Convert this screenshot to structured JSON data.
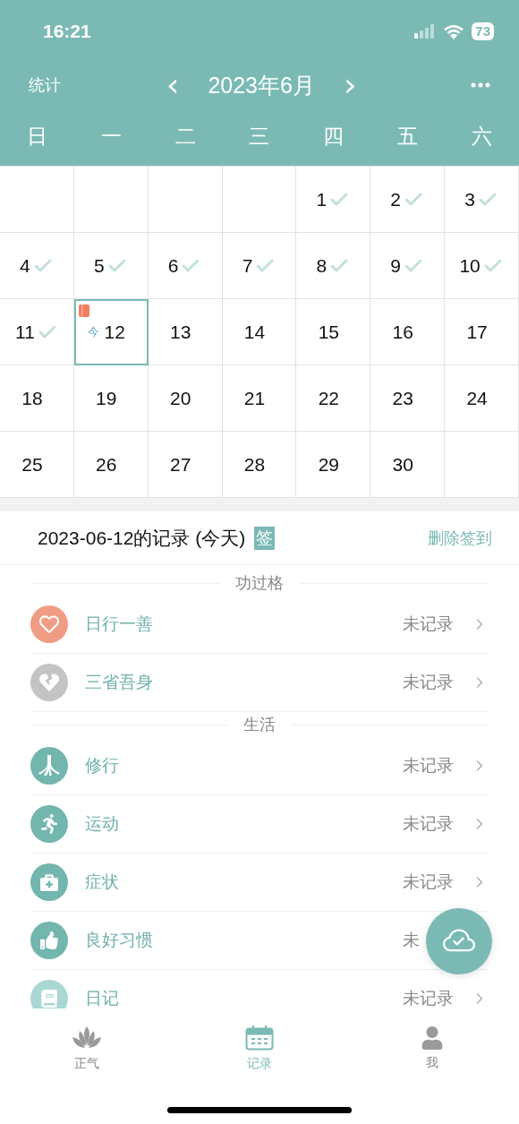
{
  "status_bar": {
    "time": "16:21",
    "battery": "73"
  },
  "nav": {
    "left": "统计",
    "month": "2023年6月",
    "prev": "‹",
    "next": "›"
  },
  "weekdays": [
    "日",
    "一",
    "二",
    "三",
    "四",
    "五",
    "六"
  ],
  "weeks": [
    [
      {
        "kind": "empty"
      },
      {
        "kind": "empty"
      },
      {
        "kind": "empty"
      },
      {
        "kind": "empty"
      },
      {
        "kind": "day",
        "day": "1",
        "checked": true,
        "today": false,
        "note": false
      },
      {
        "kind": "day",
        "day": "2",
        "checked": true,
        "today": false,
        "note": false
      },
      {
        "kind": "day",
        "day": "3",
        "checked": true,
        "today": false,
        "note": false
      }
    ],
    [
      {
        "kind": "day",
        "day": "4",
        "checked": true,
        "today": false,
        "note": false
      },
      {
        "kind": "day",
        "day": "5",
        "checked": true,
        "today": false,
        "note": false
      },
      {
        "kind": "day",
        "day": "6",
        "checked": true,
        "today": false,
        "note": false
      },
      {
        "kind": "day",
        "day": "7",
        "checked": true,
        "today": false,
        "note": false
      },
      {
        "kind": "day",
        "day": "8",
        "checked": true,
        "today": false,
        "note": false
      },
      {
        "kind": "day",
        "day": "9",
        "checked": true,
        "today": false,
        "note": false
      },
      {
        "kind": "day",
        "day": "10",
        "checked": true,
        "today": false,
        "note": false
      }
    ],
    [
      {
        "kind": "day",
        "day": "11",
        "checked": true,
        "today": false,
        "note": false
      },
      {
        "kind": "day",
        "day": "12",
        "checked": false,
        "today": true,
        "note": true,
        "today_label": "今"
      },
      {
        "kind": "day",
        "day": "13",
        "checked": false,
        "today": false,
        "note": false
      },
      {
        "kind": "day",
        "day": "14",
        "checked": false,
        "today": false,
        "note": false
      },
      {
        "kind": "day",
        "day": "15",
        "checked": false,
        "today": false,
        "note": false
      },
      {
        "kind": "day",
        "day": "16",
        "checked": false,
        "today": false,
        "note": false
      },
      {
        "kind": "day",
        "day": "17",
        "checked": false,
        "today": false,
        "note": false
      }
    ],
    [
      {
        "kind": "day",
        "day": "18",
        "checked": false,
        "today": false,
        "note": false
      },
      {
        "kind": "day",
        "day": "19",
        "checked": false,
        "today": false,
        "note": false
      },
      {
        "kind": "day",
        "day": "20",
        "checked": false,
        "today": false,
        "note": false
      },
      {
        "kind": "day",
        "day": "21",
        "checked": false,
        "today": false,
        "note": false
      },
      {
        "kind": "day",
        "day": "22",
        "checked": false,
        "today": false,
        "note": false
      },
      {
        "kind": "day",
        "day": "23",
        "checked": false,
        "today": false,
        "note": false
      },
      {
        "kind": "day",
        "day": "24",
        "checked": false,
        "today": false,
        "note": false
      }
    ],
    [
      {
        "kind": "day",
        "day": "25",
        "checked": false,
        "today": false,
        "note": false
      },
      {
        "kind": "day",
        "day": "26",
        "checked": false,
        "today": false,
        "note": false
      },
      {
        "kind": "day",
        "day": "27",
        "checked": false,
        "today": false,
        "note": false
      },
      {
        "kind": "day",
        "day": "28",
        "checked": false,
        "today": false,
        "note": false
      },
      {
        "kind": "day",
        "day": "29",
        "checked": false,
        "today": false,
        "note": false
      },
      {
        "kind": "day",
        "day": "30",
        "checked": false,
        "today": false,
        "note": false
      },
      {
        "kind": "empty"
      }
    ]
  ],
  "record": {
    "title": "2023-06-12的记录 (今天)",
    "badge": "签",
    "action": "删除签到"
  },
  "sections": [
    {
      "title": "功过格",
      "items": [
        {
          "label": "日行一善",
          "status": "未记录",
          "color": "#f09c85"
        },
        {
          "label": "三省吾身",
          "status": "未记录",
          "color": "#c4c4c4"
        }
      ]
    },
    {
      "title": "生活",
      "items": [
        {
          "label": "修行",
          "status": "未记录",
          "color": "#72b6ae"
        },
        {
          "label": "运动",
          "status": "未记录",
          "color": "#72b6ae"
        },
        {
          "label": "症状",
          "status": "未记录",
          "color": "#72b6ae"
        },
        {
          "label": "良好习惯",
          "status": "未",
          "color": "#72b6ae"
        },
        {
          "label": "日记",
          "status": "未记录",
          "color": "#a9d7d2"
        }
      ]
    }
  ],
  "tabs": [
    {
      "label": "正气",
      "selected": false
    },
    {
      "label": "记录",
      "selected": true
    },
    {
      "label": "我",
      "selected": false
    }
  ]
}
